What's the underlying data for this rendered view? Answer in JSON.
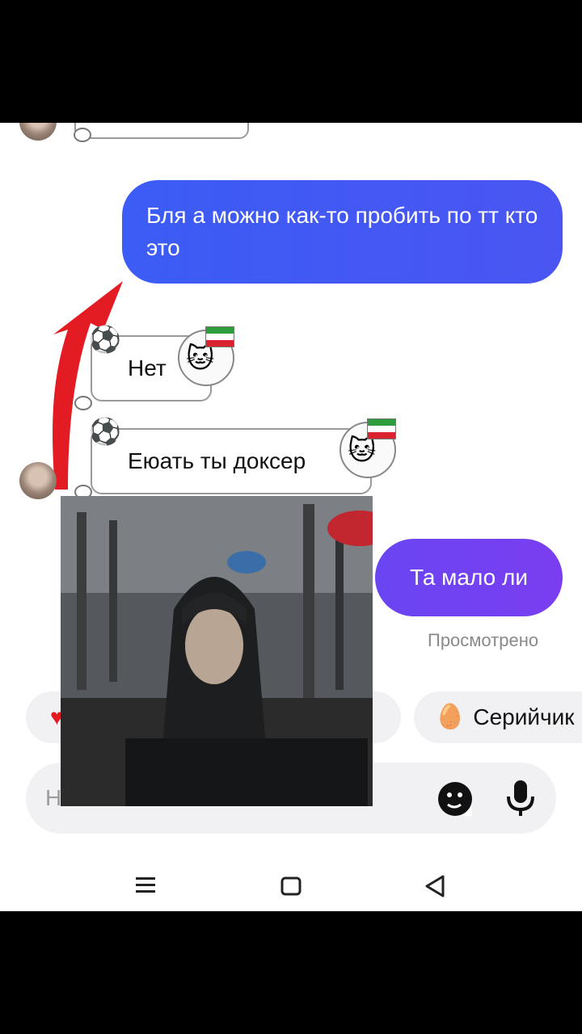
{
  "messages": {
    "outgoing_1": "Бля а можно как-то пробить по тт кто это",
    "incoming_1": "Нет",
    "incoming_2": "Еюать ты доксер",
    "outgoing_2": "Та мало ли",
    "status": "Просмотрено"
  },
  "suggestions": {
    "chip_right_label": "Серийчик"
  },
  "composer": {
    "placeholder": "Н"
  },
  "colors": {
    "bubble_blue": "#3b5cf5",
    "bubble_purple": "#6a45f2",
    "arrow_red": "#e31b23"
  },
  "icons": [
    "ball-icon",
    "cat-sticker-icon",
    "flag-icon",
    "sticker-icon",
    "mic-icon",
    "menu-icon",
    "home-icon",
    "back-icon",
    "heart-icon",
    "egg-icon"
  ]
}
